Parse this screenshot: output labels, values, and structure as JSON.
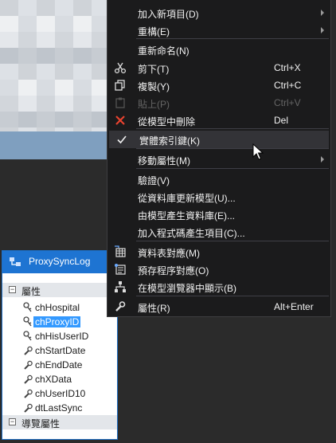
{
  "menu": {
    "items": [
      {
        "label": "加入新項目(D)",
        "shortcut": "",
        "submenu": true,
        "icon": "",
        "disabled": false
      },
      {
        "label": "重構(E)",
        "shortcut": "",
        "submenu": true,
        "icon": "",
        "disabled": false
      },
      {
        "label": "重新命名(N)",
        "shortcut": "",
        "submenu": false,
        "icon": "",
        "disabled": false
      },
      {
        "label": "剪下(T)",
        "shortcut": "Ctrl+X",
        "submenu": false,
        "icon": "scissors-icon",
        "disabled": false
      },
      {
        "label": "複製(Y)",
        "shortcut": "Ctrl+C",
        "submenu": false,
        "icon": "copy-icon",
        "disabled": false
      },
      {
        "label": "貼上(P)",
        "shortcut": "Ctrl+V",
        "submenu": false,
        "icon": "paste-icon",
        "disabled": true
      },
      {
        "label": "從模型中刪除",
        "shortcut": "Del",
        "submenu": false,
        "icon": "delete-icon",
        "disabled": false
      },
      {
        "label": "實體索引鍵(K)",
        "shortcut": "",
        "submenu": false,
        "icon": "checkmark-icon",
        "disabled": false,
        "checked": true
      },
      {
        "label": "移動屬性(M)",
        "shortcut": "",
        "submenu": true,
        "icon": "",
        "disabled": false
      },
      {
        "label": "驗證(V)",
        "shortcut": "",
        "submenu": false,
        "icon": "",
        "disabled": false
      },
      {
        "label": "從資料庫更新模型(U)...",
        "shortcut": "",
        "submenu": false,
        "icon": "",
        "disabled": false
      },
      {
        "label": "由模型產生資料庫(E)...",
        "shortcut": "",
        "submenu": false,
        "icon": "",
        "disabled": false
      },
      {
        "label": "加入程式碼產生項目(C)...",
        "shortcut": "",
        "submenu": false,
        "icon": "",
        "disabled": false
      },
      {
        "label": "資料表對應(M)",
        "shortcut": "",
        "submenu": false,
        "icon": "table-mapping-icon",
        "disabled": false
      },
      {
        "label": "預存程序對應(O)",
        "shortcut": "",
        "submenu": false,
        "icon": "stored-procedure-icon",
        "disabled": false
      },
      {
        "label": "在模型瀏覽器中顯示(B)",
        "shortcut": "",
        "submenu": false,
        "icon": "model-browser-icon",
        "disabled": false
      },
      {
        "label": "屬性(R)",
        "shortcut": "Alt+Enter",
        "submenu": false,
        "icon": "wrench-icon",
        "disabled": false
      }
    ]
  },
  "entity": {
    "title": "ProxySyncLog",
    "properties_header": "屬性",
    "navigation_header": "導覽屬性",
    "properties": [
      {
        "name": "chHospital",
        "key": true,
        "selected": false
      },
      {
        "name": "chProxyID",
        "key": true,
        "selected": true
      },
      {
        "name": "chHisUserID",
        "key": true,
        "selected": false
      },
      {
        "name": "chStartDate",
        "key": false,
        "selected": false
      },
      {
        "name": "chEndDate",
        "key": false,
        "selected": false
      },
      {
        "name": "chXData",
        "key": false,
        "selected": false
      },
      {
        "name": "chUserID10",
        "key": false,
        "selected": false
      },
      {
        "name": "dtLastSync",
        "key": false,
        "selected": false
      }
    ]
  },
  "colors": {
    "menu_bg": "#1b1b1c",
    "highlight": "#333337",
    "entity_title": "#1e74d2",
    "selection": "#3399ff",
    "delete_red": "#e8432f"
  }
}
